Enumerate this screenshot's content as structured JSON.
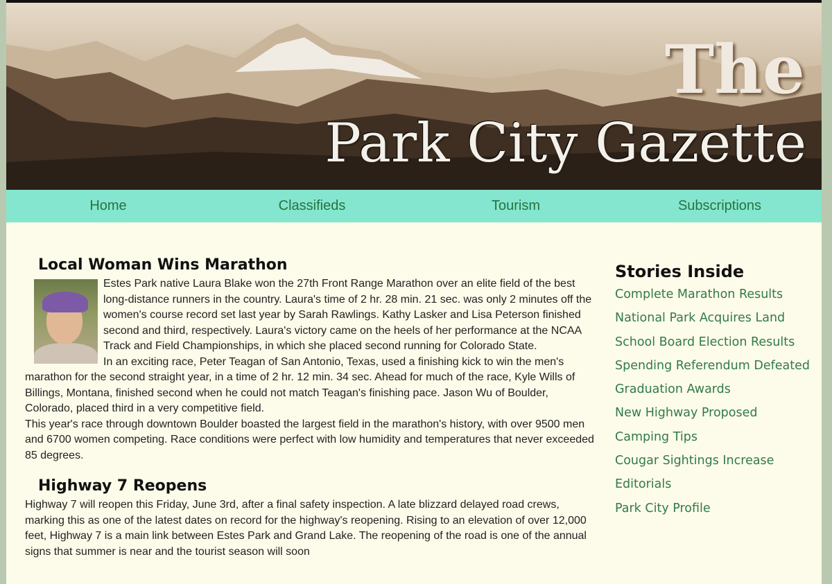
{
  "header": {
    "title_the": "The",
    "title_main": "Park City Gazette"
  },
  "nav": {
    "items": [
      "Home",
      "Classifieds",
      "Tourism",
      "Subscriptions"
    ]
  },
  "articles": [
    {
      "title": "Local Woman Wins Marathon",
      "paragraphs": [
        "Estes Park native Laura Blake won the 27th Front Range Marathon over an elite field of the best long-distance runners in the country. Laura's time of 2 hr. 28 min. 21 sec. was only 2 minutes off the women's course record set last year by Sarah Rawlings. Kathy Lasker and Lisa Peterson finished second and third, respectively. Laura's victory came on the heels of her performance at the NCAA Track and Field Championships, in which she placed second running for Colorado State.",
        "In an exciting race, Peter Teagan of San Antonio, Texas, used a finishing kick to win the men's marathon for the second straight year, in a time of 2 hr. 12 min. 34 sec. Ahead for much of the race, Kyle Wills of Billings, Montana, finished second when he could not match Teagan's finishing pace. Jason Wu of Boulder, Colorado, placed third in a very competitive field.",
        "This year's race through downtown Boulder boasted the largest field in the marathon's history, with over 9500 men and 6700 women competing. Race conditions were perfect with low humidity and temperatures that never exceeded 85 degrees."
      ]
    },
    {
      "title": "Highway 7 Reopens",
      "paragraphs": [
        "Highway 7 will reopen this Friday, June 3rd, after a final safety inspection. A late blizzard delayed road crews, marking this as one of the latest dates on record for the highway's reopening. Rising to an elevation of over 12,000 feet, Highway 7 is a main link between Estes Park and Grand Lake. The reopening of the road is one of the annual signs that summer is near and the tourist season will soon"
      ]
    }
  ],
  "sidebar": {
    "title": "Stories Inside",
    "links": [
      "Complete Marathon Results",
      "National Park Acquires Land",
      "School Board Election Results",
      "Spending Referendum Defeated",
      "Graduation Awards",
      "New Highway Proposed",
      "Camping Tips",
      "Cougar Sightings Increase",
      "Editorials",
      "Park City Profile"
    ]
  },
  "colors": {
    "nav_bg": "#84e6cf",
    "link": "#327a4a",
    "page_bg": "#fdfbe9"
  }
}
